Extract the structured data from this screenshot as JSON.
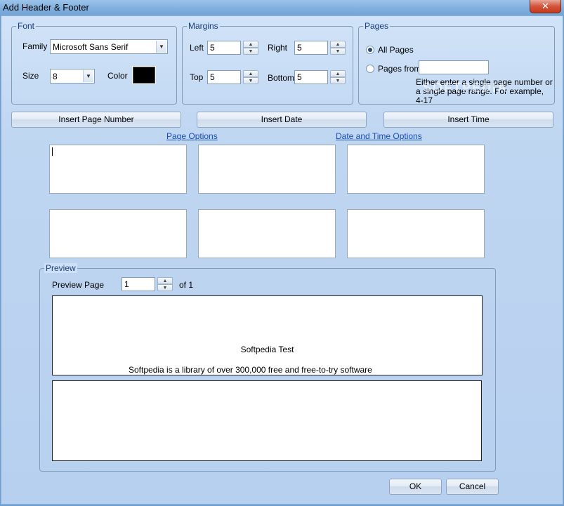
{
  "window": {
    "title": "Add Header & Footer",
    "close_glyph": "✕"
  },
  "font": {
    "legend": "Font",
    "family_label": "Family",
    "family_value": "Microsoft Sans Serif",
    "size_label": "Size",
    "size_value": "8",
    "color_label": "Color",
    "color_value": "#000000"
  },
  "margins": {
    "legend": "Margins",
    "left_label": "Left",
    "left_value": "5",
    "right_label": "Right",
    "right_value": "5",
    "top_label": "Top",
    "top_value": "5",
    "bottom_label": "Bottom",
    "bottom_value": "5"
  },
  "pages": {
    "legend": "Pages",
    "all_pages_label": "All Pages",
    "pages_from_label": "Pages from",
    "pages_from_value": "",
    "hint": "Either enter a single page number or a single page range. For example, 4-17",
    "selected": "all"
  },
  "toolbar": {
    "insert_page_number": "Insert Page Number",
    "insert_date": "Insert Date",
    "insert_time": "Insert Time"
  },
  "links": {
    "page_options": "Page Options",
    "date_time_options": "Date and Time Options"
  },
  "preview": {
    "legend": "Preview",
    "page_label": "Preview Page",
    "page_value": "1",
    "of_label": "of 1",
    "header_line": "Softpedia Test",
    "body_line": "Softpedia is a library of over 300,000 free and free-to-try software"
  },
  "dialog": {
    "ok": "OK",
    "cancel": "Cancel"
  },
  "watermark": "SOFTPEDIA"
}
